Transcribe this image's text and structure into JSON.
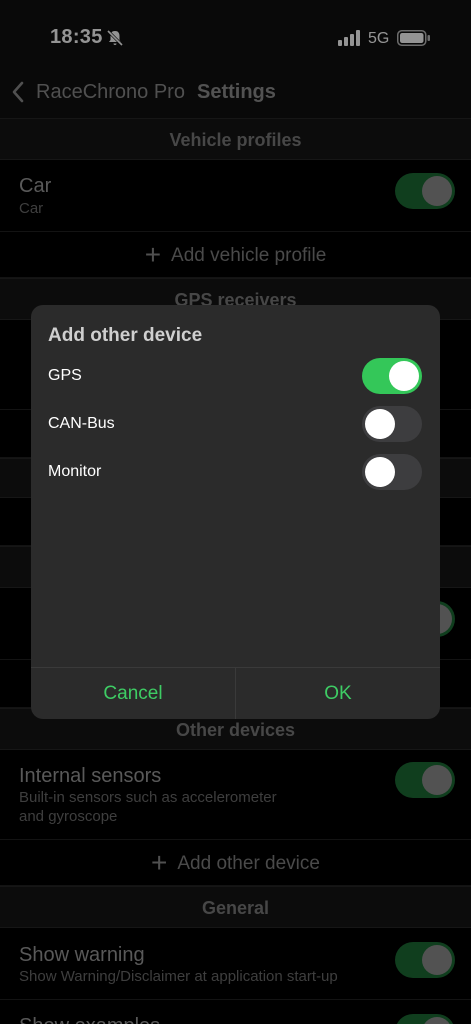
{
  "status_bar": {
    "time": "18:35",
    "network": "5G"
  },
  "nav": {
    "back_label": "RaceChrono Pro",
    "title": "Settings"
  },
  "sections": {
    "vehicle_profiles": "Vehicle profiles",
    "gps_receivers": "GPS receivers",
    "other_devices": "Other devices",
    "general": "General"
  },
  "vehicle": {
    "title": "Car",
    "subtitle": "Car",
    "enabled": true
  },
  "add_vehicle_label": "Add vehicle profile",
  "internal_sensors": {
    "title": "Internal sensors",
    "subtitle_line1": "Built-in sensors such as accelerometer",
    "subtitle_line2": "and gyroscope",
    "enabled": true
  },
  "add_other_device_label": "Add other device",
  "show_warning": {
    "title": "Show warning",
    "subtitle": "Show Warning/Disclaimer at application start-up",
    "enabled": true
  },
  "show_examples": {
    "title": "Show examples"
  },
  "dialog": {
    "title": "Add other device",
    "options": [
      {
        "label": "GPS",
        "enabled": true
      },
      {
        "label": "CAN-Bus",
        "enabled": false
      },
      {
        "label": "Monitor",
        "enabled": false
      }
    ],
    "cancel_label": "Cancel",
    "ok_label": "OK"
  },
  "colors": {
    "accent": "#34c759",
    "button_text": "#3ecc64",
    "dialog_bg": "#2b2b2b"
  }
}
